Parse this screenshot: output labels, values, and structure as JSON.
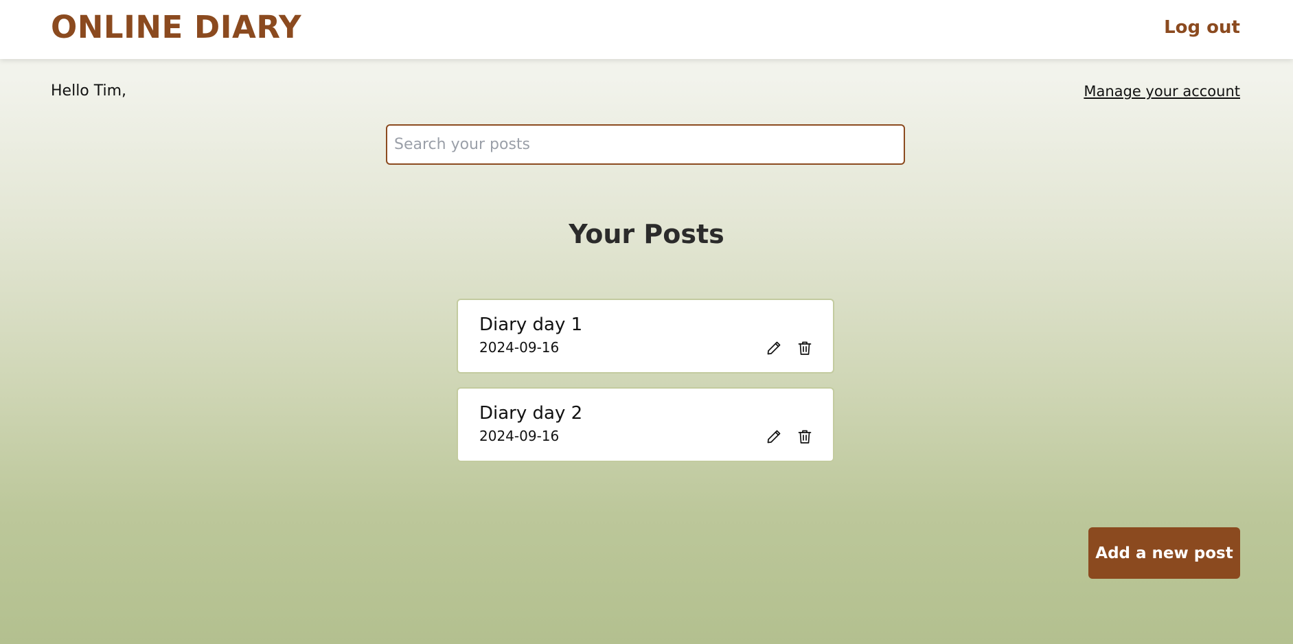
{
  "header": {
    "brand": "ONLINE DIARY",
    "logout_label": "Log out"
  },
  "greeting": "Hello Tim,",
  "account_link": "Manage your account",
  "search": {
    "placeholder": "Search your posts",
    "value": ""
  },
  "posts_heading": "Your Posts",
  "posts": [
    {
      "title": "Diary day 1",
      "date": "2024-09-16",
      "edit_icon": "pencil-icon",
      "delete_icon": "trash-icon"
    },
    {
      "title": "Diary day 2",
      "date": "2024-09-16",
      "edit_icon": "pencil-icon",
      "delete_icon": "trash-icon"
    }
  ],
  "add_post_label": "Add a new post",
  "colors": {
    "accent": "#8b4a1f",
    "card_border": "#c3cb9f",
    "background_top": "#f4f4ef",
    "background_bottom": "#b3c08f"
  }
}
